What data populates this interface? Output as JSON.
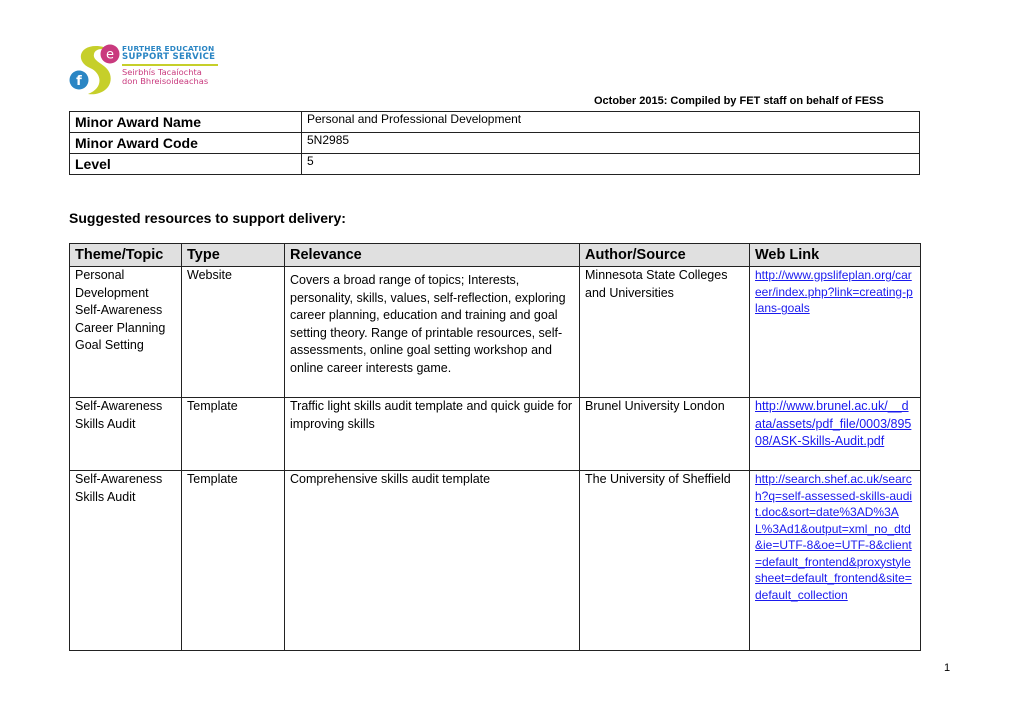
{
  "header": {
    "logo": {
      "line1": "FURTHER EDUCATION",
      "line2": "SUPPORT SERVICE",
      "line3": "Seirbhís Tacaíochta",
      "line4": "don Bhreisoideachas",
      "colors": {
        "blue": "#2b86c4",
        "pink": "#c93a7e",
        "lime": "#c6cf2a"
      }
    },
    "compiled_note": "October 2015: Compiled by FET staff on behalf of FESS"
  },
  "award": {
    "rows": [
      {
        "label": "Minor Award Name",
        "value": "Personal and Professional Development"
      },
      {
        "label": "Minor Award Code",
        "value": "5N2985"
      },
      {
        "label": "Level",
        "value": "5"
      }
    ]
  },
  "section_title": "Suggested resources to support delivery:",
  "resources": {
    "columns": [
      "Theme/Topic",
      "Type",
      "Relevance",
      "Author/Source",
      "Web Link"
    ],
    "rows": [
      {
        "theme": [
          "Personal",
          "Development",
          "Self-Awareness",
          "Career Planning",
          "Goal Setting"
        ],
        "type": "Website",
        "relevance": "Covers a broad range of topics; Interests, personality, skills, values, self-reflection, exploring career planning, education and training and goal setting theory. Range of printable resources, self-assessments, online goal setting workshop and online career interests game.",
        "author": "Minnesota State Colleges and Universities",
        "link": "http://www.gpslifeplan.org/career/index.php?link=creating-plans-goals"
      },
      {
        "theme": [
          "Self-Awareness",
          "Skills Audit"
        ],
        "type": "Template",
        "relevance": "Traffic light skills audit template and quick guide for improving skills",
        "author": "Brunel University London",
        "link": "http://www.brunel.ac.uk/__data/assets/pdf_file/0003/89508/ASK-Skills-Audit.pdf"
      },
      {
        "theme": [
          "Self-Awareness",
          "Skills Audit"
        ],
        "type": "Template",
        "relevance": "Comprehensive skills audit template",
        "author": "The University of Sheffield",
        "link": "http://search.shef.ac.uk/search?q=self-assessed-skills-audit.doc&sort=date%3AD%3AL%3Ad1&output=xml_no_dtd&ie=UTF-8&oe=UTF-8&client=default_frontend&proxystylesheet=default_frontend&site=default_collection"
      }
    ]
  },
  "footer": {
    "page_number": "1"
  }
}
